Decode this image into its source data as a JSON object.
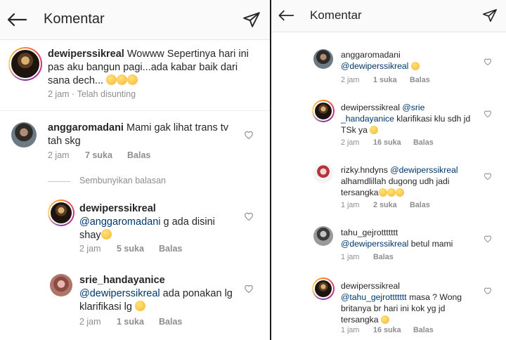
{
  "header": {
    "title": "Komentar"
  },
  "left": {
    "caption": {
      "username": "dewiperssikreal",
      "text": " Wowww Sepertinya hari ini pas aku bangun pagi...ada kabar baik dari sana dech... ",
      "time": "2 jam",
      "edited": "Telah disunting"
    },
    "comment1": {
      "username": "anggaromadani",
      "text": " Mami gak lihat trans tv tah skg",
      "time": "2 jam",
      "likes": "7 suka",
      "reply": "Balas"
    },
    "hide_replies": "Sembunyikan balasan",
    "reply1": {
      "username": "dewiperssikreal",
      "mention": "@anggaromadani",
      "text": " g ada disini shay",
      "time": "2 jam",
      "likes": "5 suka",
      "reply": "Balas"
    },
    "reply2": {
      "username": "srie_handayanice",
      "mention": "@dewiperssikreal",
      "text": " ada ponakan lg klarifikasi lg ",
      "time": "2 jam",
      "likes": "1 suka",
      "reply": "Balas"
    }
  },
  "right": {
    "c1": {
      "username": "anggaromadani",
      "mention": "@dewiperssikreal",
      "time": "2 jam",
      "likes": "1 suka",
      "reply": "Balas"
    },
    "c2": {
      "username": "dewiperssikreal",
      "mention1": "@srie",
      "mention2": "_handayanice",
      "text": " klarifikasi klu sdh jd TSk ya ",
      "time": "2 jam",
      "likes": "16 suka",
      "reply": "Balas"
    },
    "c3": {
      "username": "rizky.hndyns",
      "mention": "@dewiperssikreal",
      "text": "alhamdlillah dugong udh jadi tersangka",
      "time": "1 jam",
      "likes": "2 suka",
      "reply": "Balas"
    },
    "c4": {
      "username": "tahu_gejrottttttt",
      "mention": "@dewiperssikreal",
      "text": " betul mami",
      "time": "1 jam",
      "reply": "Balas"
    },
    "c5": {
      "username": "dewiperssikreal",
      "mention": "@tahu_gejrottttttt",
      "text": " masa ? Wong britanya br hari ini kok yg jd tersangka ",
      "time": "1 jam",
      "likes": "16 suka",
      "reply": "Balas"
    }
  },
  "icons": {
    "back": "arrow-left-icon",
    "send": "paper-plane-icon",
    "like": "heart-outline-icon"
  }
}
